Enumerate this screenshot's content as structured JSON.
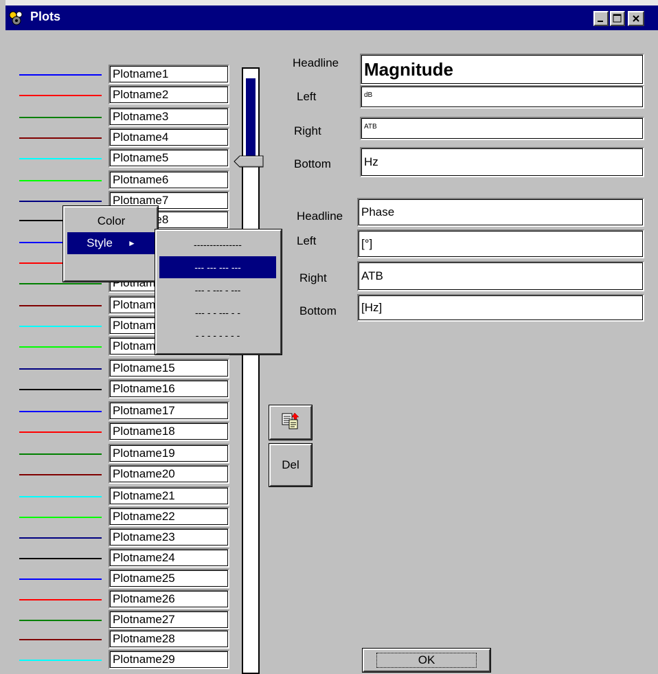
{
  "window": {
    "title": "Plots",
    "controls": {
      "minimize": "_",
      "maximize": "□",
      "close": "X"
    }
  },
  "plots": [
    {
      "name": "Plotname1",
      "color": "#0000ff"
    },
    {
      "name": "Plotname2",
      "color": "#ff0000"
    },
    {
      "name": "Plotname3",
      "color": "#008000"
    },
    {
      "name": "Plotname4",
      "color": "#800000"
    },
    {
      "name": "Plotname5",
      "color": "#00ffff"
    },
    {
      "name": "Plotname6",
      "color": "#00ff00"
    },
    {
      "name": "Plotname7",
      "color": "#000080"
    },
    {
      "name": "Plotname8",
      "color": "#000000"
    },
    {
      "name": "Plotname9",
      "color": "#0000ff"
    },
    {
      "name": "Plotname10",
      "color": "#ff0000"
    },
    {
      "name": "Plotname11",
      "color": "#008000"
    },
    {
      "name": "Plotname12",
      "color": "#800000"
    },
    {
      "name": "Plotname13",
      "color": "#00ffff"
    },
    {
      "name": "Plotname14",
      "color": "#00ff00"
    },
    {
      "name": "Plotname15",
      "color": "#000080"
    },
    {
      "name": "Plotname16",
      "color": "#000000"
    },
    {
      "name": "Plotname17",
      "color": "#0000ff"
    },
    {
      "name": "Plotname18",
      "color": "#ff0000"
    },
    {
      "name": "Plotname19",
      "color": "#008000"
    },
    {
      "name": "Plotname20",
      "color": "#800000"
    },
    {
      "name": "Plotname21",
      "color": "#00ffff"
    },
    {
      "name": "Plotname22",
      "color": "#00ff00"
    },
    {
      "name": "Plotname23",
      "color": "#000080"
    },
    {
      "name": "Plotname24",
      "color": "#000000"
    },
    {
      "name": "Plotname25",
      "color": "#0000ff"
    },
    {
      "name": "Plotname26",
      "color": "#ff0000"
    },
    {
      "name": "Plotname27",
      "color": "#008000"
    },
    {
      "name": "Plotname28",
      "color": "#800000"
    },
    {
      "name": "Plotname29",
      "color": "#00ffff"
    }
  ],
  "magnitude": {
    "headline_label": "Headline",
    "headline_value": "Magnitude",
    "left_label": "Left",
    "left_value": "dB",
    "right_label": "Right",
    "right_value": "ATB",
    "bottom_label": "Bottom",
    "bottom_value": "Hz"
  },
  "phase": {
    "headline_label": "Headline",
    "headline_value": "Phase",
    "left_label": "Left",
    "left_value": "[°]",
    "right_label": "Right",
    "right_value": "ATB",
    "bottom_label": "Bottom",
    "bottom_value": "[Hz]"
  },
  "context_menu": {
    "color_label": "Color",
    "style_label": "Style",
    "style_arrow": "►"
  },
  "style_submenu": [
    "---------------",
    "--- --- --- ---",
    "--- - --- - ---",
    "--- - - --- - -",
    "- - - - - - - -"
  ],
  "buttons": {
    "del_label": "Del",
    "ok_label": "OK",
    "copy_icon": "copy-paste-icon"
  },
  "scroll": {
    "position": 0.0
  }
}
